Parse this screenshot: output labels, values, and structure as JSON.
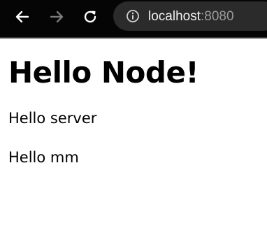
{
  "browser": {
    "url_host": "localhost",
    "url_port": ":8080",
    "icons": {
      "back": "arrow-left-icon",
      "forward": "arrow-right-icon",
      "reload": "reload-icon",
      "site_info": "info-icon"
    }
  },
  "page": {
    "heading": "Hello Node!",
    "paragraphs": [
      "Hello server",
      "Hello mm"
    ]
  }
}
